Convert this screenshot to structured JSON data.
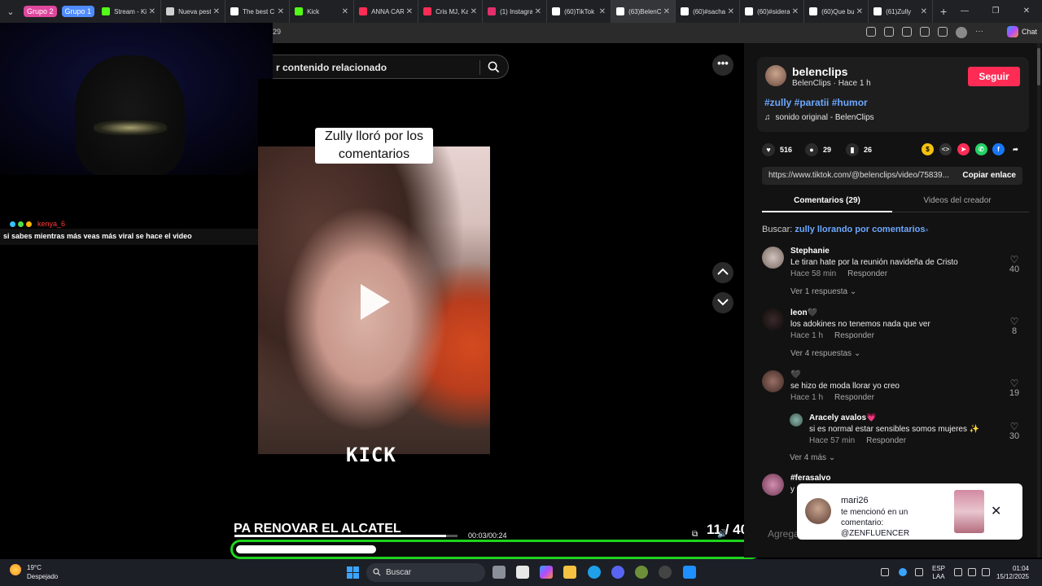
{
  "browser": {
    "groups": [
      {
        "label": "Grupo 2",
        "color": "#e0479e"
      },
      {
        "label": "Grupo 1",
        "color": "#4f8cff"
      }
    ],
    "tabs": [
      {
        "title": "Stream - Ki",
        "icon": "kick-icon",
        "color": "#53fc18"
      },
      {
        "title": "Nueva pest",
        "icon": "newtab-icon",
        "color": "#cfcfcf"
      },
      {
        "title": "The best C",
        "icon": "diamond-icon",
        "color": "#ffffff"
      },
      {
        "title": "Kick",
        "icon": "kick-icon",
        "color": "#53fc18"
      },
      {
        "title": "ANNA CAR",
        "icon": "video-icon",
        "color": "#ff2d55"
      },
      {
        "title": "Cris MJ, Ka",
        "icon": "video-icon",
        "color": "#ff2d55"
      },
      {
        "title": "(1) Instagra",
        "icon": "instagram-icon",
        "color": "#e1306c"
      },
      {
        "title": "(60)TikTok",
        "icon": "tiktok-icon",
        "color": "#ffffff"
      },
      {
        "title": "(63)BelenC",
        "icon": "tiktok-icon",
        "color": "#ffffff",
        "active": true
      },
      {
        "title": "(60)#sacha",
        "icon": "tiktok-icon",
        "color": "#ffffff"
      },
      {
        "title": "(60)#sidera",
        "icon": "tiktok-icon",
        "color": "#ffffff"
      },
      {
        "title": "(60)Que bu",
        "icon": "tiktok-icon",
        "color": "#ffffff"
      },
      {
        "title": "(61)Zully",
        "icon": "tiktok-icon",
        "color": "#ffffff"
      }
    ],
    "url_fragment": "29",
    "chat_label": "Chat"
  },
  "stream_chat": {
    "username": "kenya_6",
    "message": "si sabes mientras más veas más viral se hace el video"
  },
  "search": {
    "placeholder": "r contenido relacionado"
  },
  "video": {
    "caption_line1": "Zully lloró por los",
    "caption_line2": "comentarios",
    "watermark": "KICK",
    "overlay_title": "PA RENOVAR EL ALCATEL",
    "time": "00:03/00:24",
    "counter": "11 / 40",
    "progress": 0.27,
    "mini_progress": 0.95
  },
  "creator": {
    "username": "belenclips",
    "subtitle": "BelenClips · Hace 1 h",
    "follow_label": "Seguir",
    "hashtags": "#zully #paratii #humor",
    "sound": "sonido original - BelenClips"
  },
  "stats": {
    "likes": "516",
    "comments": "29",
    "saves": "26"
  },
  "share": {
    "link": "https://www.tiktok.com/@belenclips/video/75839...",
    "copy_label": "Copiar enlace"
  },
  "panel_tabs": {
    "comments": "Comentarios (29)",
    "creator_videos": "Videos del creador"
  },
  "search_hint": {
    "prefix": "Buscar:",
    "query": "zully llorando por comentarios"
  },
  "comments": [
    {
      "name": "Stephanie",
      "text": "Le tiran hate por la reunión navideña de Cristo",
      "time": "Hace 58 min",
      "reply": "Responder",
      "likes": "40",
      "more": "Ver 1 respuesta"
    },
    {
      "name": "leon🖤",
      "text": "los adokines no tenemos nada que ver",
      "time": "Hace 1 h",
      "reply": "Responder",
      "likes": "8",
      "more": "Ver 4 respuestas"
    },
    {
      "name": "🖤",
      "text": "se hizo de moda llorar yo creo",
      "time": "Hace 1 h",
      "reply": "Responder",
      "likes": "19",
      "more": ""
    },
    {
      "name": "Aracely avalos💗",
      "text": "si es normal estar sensibles somos mujeres ✨",
      "time": "Hace 57 min",
      "reply": "Responder",
      "likes": "30",
      "more": "Ver 4 más"
    },
    {
      "name": "#ferasalvo",
      "text": "y",
      "time": "",
      "reply": "",
      "likes": "",
      "more": ""
    }
  ],
  "notification": {
    "user": "mari26",
    "message": "te mencionó en un comentario: @ZENFLUENCER"
  },
  "add_comment_placeholder": "Agrega",
  "taskbar": {
    "temp": "19°C",
    "weather": "Despejado",
    "search_label": "Buscar",
    "lang1": "ESP",
    "lang2": "LAA",
    "time": "01:04",
    "date": "15/12/2025"
  }
}
